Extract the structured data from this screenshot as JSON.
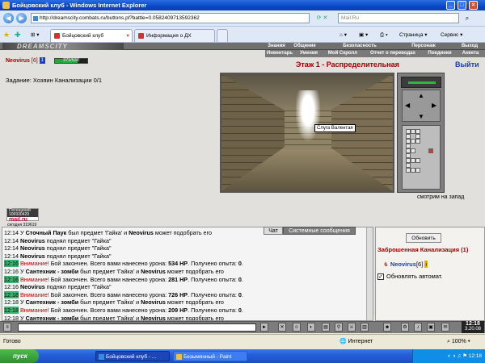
{
  "window": {
    "title": "Бойцовский клуб - Windows Internet Explorer"
  },
  "browser": {
    "url": "http://dreamscity.combats.ru/buttons.pl?battle=0.0582409713592362",
    "search_placeholder": "Mail.Ru",
    "tabs": [
      {
        "label": "Бойцовский клуб",
        "active": true
      },
      {
        "label": "Информация о ДХ",
        "active": false
      }
    ],
    "toolbar": {
      "page": "Страница",
      "tools": "Сервис"
    },
    "status": {
      "left": "Готово",
      "zone": "Интернет",
      "zoom": "100%"
    }
  },
  "game": {
    "logo": "DREAMSCITY",
    "nav_top": [
      "Знания",
      "Общение",
      "Безопасность",
      "Персонаж",
      "Выход"
    ],
    "nav_bottom": [
      "Инвентарь",
      "Умения",
      "Мой Скролл",
      "Отчет о переводах",
      "Поединки",
      "Анкета"
    ],
    "player": {
      "name": "Neovirus",
      "level": "[6]",
      "badge": "1",
      "hp_text": "373/530",
      "hp_fraction": 0.7
    },
    "task": "Задание: Хозяин Канализации 0/1",
    "floor_title": "Этаж 1 - Распределительная",
    "exit_label": "Выйти",
    "npc_label": "Слуга Валентая",
    "direction": "смотрим на запад",
    "counter": {
      "line1": "Посещений 106930429",
      "brand": "mail.ru",
      "line2": "сегодня 319619"
    },
    "chat_tab": "Чат",
    "system_tab": "Системные сообщения",
    "chat_lines": [
      {
        "time": "12:14",
        "hl": false,
        "parts": [
          [
            "",
            "У "
          ],
          [
            "b",
            "Сточный Паук"
          ],
          [
            "",
            " был предмет 'Гайка' и "
          ],
          [
            "b",
            "Neovirus"
          ],
          [
            "",
            " может подобрать его"
          ]
        ]
      },
      {
        "time": "12:14",
        "hl": false,
        "parts": [
          [
            "b",
            "Neovirus"
          ],
          [
            "",
            " поднял предмет \"Гайка\""
          ]
        ]
      },
      {
        "time": "12:14",
        "hl": false,
        "parts": [
          [
            "b",
            "Neovirus"
          ],
          [
            "",
            " поднял предмет \"Гайка\""
          ]
        ]
      },
      {
        "time": "12:14",
        "hl": false,
        "parts": [
          [
            "b",
            "Neovirus"
          ],
          [
            "",
            " поднял предмет \"Гайка\""
          ]
        ]
      },
      {
        "time": "12:16",
        "hl": true,
        "parts": [
          [
            "red",
            "Внимание!"
          ],
          [
            "",
            " Бой закончен. Всего вами нанесено урона: "
          ],
          [
            "b",
            "534 HP"
          ],
          [
            "",
            ". Получено опыта: "
          ],
          [
            "b",
            "0"
          ],
          [
            "",
            "."
          ]
        ]
      },
      {
        "time": "12:16",
        "hl": false,
        "parts": [
          [
            "",
            "У "
          ],
          [
            "b",
            "Сантехник - зомби"
          ],
          [
            "",
            " был предмет 'Гайка' и "
          ],
          [
            "b",
            "Neovirus"
          ],
          [
            "",
            " может подобрать его"
          ]
        ]
      },
      {
        "time": "12:16",
        "hl": true,
        "parts": [
          [
            "red",
            "Внимание!"
          ],
          [
            "",
            " Бой закончен. Всего вами нанесено урона: "
          ],
          [
            "b",
            "281 HP"
          ],
          [
            "",
            ". Получено опыта: "
          ],
          [
            "b",
            "0"
          ],
          [
            "",
            "."
          ]
        ]
      },
      {
        "time": "12:16",
        "hl": false,
        "parts": [
          [
            "b",
            "Neovirus"
          ],
          [
            "",
            " поднял предмет \"Гайка\""
          ]
        ]
      },
      {
        "time": "12:18",
        "hl": true,
        "parts": [
          [
            "red",
            "Внимание!"
          ],
          [
            "",
            " Бой закончен. Всего вами нанесено урона: "
          ],
          [
            "b",
            "726 HP"
          ],
          [
            "",
            ". Получено опыта: "
          ],
          [
            "b",
            "0"
          ],
          [
            "",
            "."
          ]
        ]
      },
      {
        "time": "12:18",
        "hl": false,
        "parts": [
          [
            "",
            "У "
          ],
          [
            "b",
            "Сантехник - зомби"
          ],
          [
            "",
            " был предмет 'Гайка' и "
          ],
          [
            "b",
            "Neovirus"
          ],
          [
            "",
            " может подобрать его"
          ]
        ]
      },
      {
        "time": "12:18",
        "hl": true,
        "parts": [
          [
            "red",
            "Внимание!"
          ],
          [
            "",
            " Бой закончен. Всего вами нанесено урона: "
          ],
          [
            "b",
            "209 HP"
          ],
          [
            "",
            ". Получено опыта: "
          ],
          [
            "b",
            "0"
          ],
          [
            "",
            "."
          ]
        ]
      },
      {
        "time": "12:18",
        "hl": false,
        "parts": [
          [
            "",
            "У "
          ],
          [
            "b",
            "Сантехник - зомби"
          ],
          [
            "",
            " был предмет 'Гайка' и "
          ],
          [
            "b",
            "Neovirus"
          ],
          [
            "",
            " может подобрать его"
          ]
        ]
      }
    ],
    "panel": {
      "refresh": "Обновить",
      "location": "Заброшенная Канализация (1)",
      "occupant_name": "Neovirus",
      "occupant_level": "[6]",
      "auto_update": "Обновлять автомат.",
      "auto_checked": "✓"
    },
    "clock": {
      "time": "12:18",
      "date": "3.20.08"
    }
  },
  "taskbar": {
    "start": "пуск",
    "tasks": [
      "Бойцовский клуб - ...",
      "Безымянный - Paint"
    ],
    "tray_time": "12:18"
  },
  "colors": {
    "title_red": "#a00000",
    "player_blue": "#1a3ea6",
    "hp_green": "#24a63a",
    "chat_highlight": "#3cb371"
  }
}
